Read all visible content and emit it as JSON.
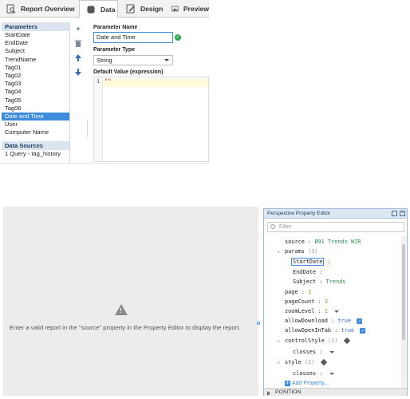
{
  "designer": {
    "tabs": [
      {
        "label": "Report Overview",
        "icon": "magnifier-icon"
      },
      {
        "label": "Data",
        "icon": "database-icon"
      },
      {
        "label": "Design",
        "icon": "pencil-icon"
      },
      {
        "label": "Preview",
        "icon": "image-icon"
      }
    ],
    "parameters_header": "Parameters",
    "parameters": [
      "StartDate",
      "EndDate",
      "Subject",
      "TrendName",
      "Tag01",
      "Tag02",
      "Tag03",
      "Tag04",
      "Tag05",
      "Tag06",
      "Date and Time",
      "User",
      "Computer Name"
    ],
    "selected_parameter": "Date and Time",
    "datasources_header": "Data Sources",
    "datasources": [
      "1 Query - tag_history"
    ],
    "tools": [
      "add-icon",
      "delete-icon",
      "move-up-icon",
      "move-down-icon"
    ],
    "param_name_label": "Parameter Name",
    "param_name_value": "Date and Time",
    "param_type_label": "Parameter Type",
    "param_type_value": "String",
    "default_value_label": "Default Value (expression)",
    "editor_line_no": "1",
    "editor_code": "\"\""
  },
  "perspective": {
    "canvas_message": "Enter a valid report in the \"source\" property in the Property Editor to display the report.",
    "editor_title": "Perspective Property Editor",
    "filter_placeholder": "Filter",
    "props": {
      "source_key": "source",
      "source_val": "B91 Trends WIR",
      "params_key": "params",
      "params_count": "(3)",
      "startdate_key": "StartDate",
      "enddate_key": "EndDate",
      "subject_key": "Subject",
      "subject_val": "Trends",
      "page_key": "page",
      "page_val": "1",
      "pagecount_key": "pageCount",
      "pagecount_val": "3",
      "zoom_key": "zoomLevel",
      "zoom_val": "1",
      "allowdownload_key": "allowDownload",
      "allowdownload_val": "true",
      "allowopen_key": "allowOpenInTab",
      "allowopen_val": "true",
      "controlstyle_key": "controlStyle",
      "controlstyle_count": "(1)",
      "classes_key": "classes",
      "style_key": "style",
      "style_count": "(1)",
      "classes2_key": "classes",
      "add_property": "Add Property..."
    },
    "section_position": "POSITION"
  }
}
